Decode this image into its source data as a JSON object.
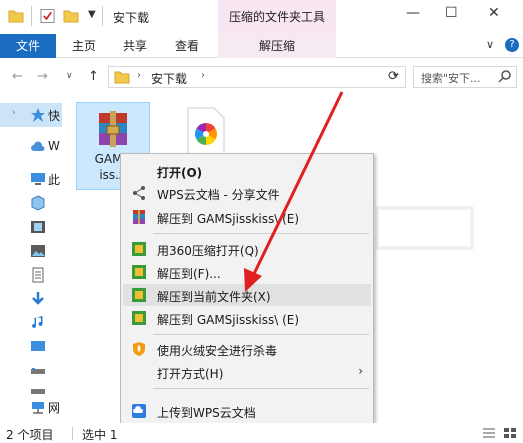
{
  "window": {
    "title": "安下载",
    "context_tool_title": "压缩的文件夹工具",
    "minimize": "—",
    "maximize": "☐",
    "close": "✕"
  },
  "ribbon": {
    "tabs": [
      "文件",
      "主页",
      "共享",
      "查看",
      "解压缩"
    ],
    "expand": "∨",
    "help": "?"
  },
  "address": {
    "path": "安下载",
    "search_placeholder": "搜索\"安下..."
  },
  "sidebar": {
    "items": [
      {
        "label": "快",
        "icon": "star-icon"
      },
      {
        "label": "W",
        "icon": "cloud-icon"
      },
      {
        "label": "此",
        "icon": "computer-icon"
      },
      {
        "label": "",
        "icon": "object-icon"
      },
      {
        "label": "",
        "icon": "video-icon"
      },
      {
        "label": "",
        "icon": "image-icon"
      },
      {
        "label": "",
        "icon": "document-icon"
      },
      {
        "label": "",
        "icon": "download-icon"
      },
      {
        "label": "",
        "icon": "music-icon"
      },
      {
        "label": "",
        "icon": "desktop-icon"
      },
      {
        "label": "",
        "icon": "drive-icon"
      },
      {
        "label": "",
        "icon": "drive-icon"
      },
      {
        "label": "网",
        "icon": "network-icon"
      }
    ]
  },
  "files": [
    {
      "name_line1": "GAMSj",
      "name_line2": "iss.zi"
    },
    {
      "name": ""
    }
  ],
  "context_menu": {
    "items": [
      {
        "label": "打开(O)",
        "bold": true
      },
      {
        "label": "WPS云文档 - 分享文件"
      },
      {
        "label": "解压到 GAMSjisskiss\\ (E)"
      },
      {
        "label": "用360压缩打开(Q)"
      },
      {
        "label": "解压到(F)..."
      },
      {
        "label": "解压到当前文件夹(X)"
      },
      {
        "label": "解压到 GAMSjisskiss\\ (E)"
      },
      {
        "label": "使用火绒安全进行杀毒"
      },
      {
        "label": "打开方式(H)",
        "arrow": "›"
      },
      {
        "label": "上传到WPS云文档"
      }
    ],
    "highlighted_index": 5
  },
  "status": {
    "count": "2 个项目",
    "selected": "选中 1"
  },
  "colors": {
    "file_tab": "#1a6cc0",
    "context_tab": "#f9e6f3",
    "selection": "#cce8ff",
    "arrow": "#e02020"
  }
}
